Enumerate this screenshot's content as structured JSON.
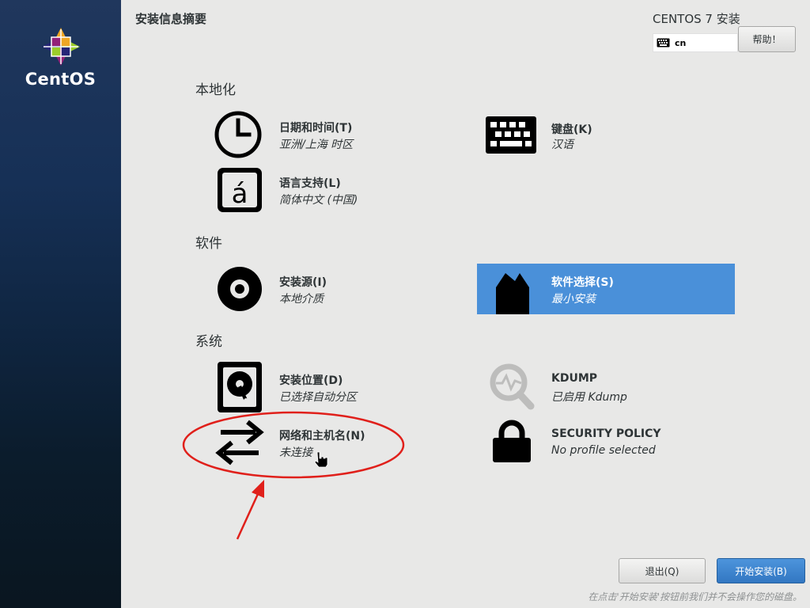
{
  "brand": {
    "logo_text": "CentOS"
  },
  "header": {
    "page_title": "安装信息摘要",
    "product_title": "CENTOS 7 安装",
    "keyboard_layout": "cn",
    "help_label": "帮助！"
  },
  "sections": {
    "localization": "本地化",
    "software": "软件",
    "system": "系统"
  },
  "spokes": {
    "datetime": {
      "name": "日期和时间(T)",
      "status": "亚洲/上海 时区",
      "icon": "clock-icon"
    },
    "keyboard": {
      "name": "键盘(K)",
      "status": "汉语",
      "icon": "keyboard-icon"
    },
    "language": {
      "name": "语言支持(L)",
      "status": "简体中文 (中国)",
      "icon": "language-icon"
    },
    "install_source": {
      "name": "安装源(I)",
      "status": "本地介质",
      "icon": "disc-icon"
    },
    "software_selection": {
      "name": "软件选择(S)",
      "status": "最小安装",
      "icon": "package-icon",
      "selected": true
    },
    "install_destination": {
      "name": "安装位置(D)",
      "status": "已选择自动分区",
      "icon": "hard-disk-icon"
    },
    "kdump": {
      "name": "KDUMP",
      "status": "已启用 Kdump",
      "icon": "magnifier-icon"
    },
    "network": {
      "name": "网络和主机名(N)",
      "status": "未连接",
      "icon": "network-arrows-icon"
    },
    "security_policy": {
      "name": "SECURITY POLICY",
      "status": "No profile selected",
      "icon": "padlock-icon"
    }
  },
  "footer": {
    "quit_label": "退出(Q)",
    "begin_label": "开始安装(B)",
    "note": "在点击'开始安装'按钮前我们并不会操作您的磁盘。"
  },
  "colors": {
    "background": "#e8e8e7",
    "selected": "#4a90d9",
    "primary_button": "#3a83cf",
    "annotation": "#e0201b"
  }
}
